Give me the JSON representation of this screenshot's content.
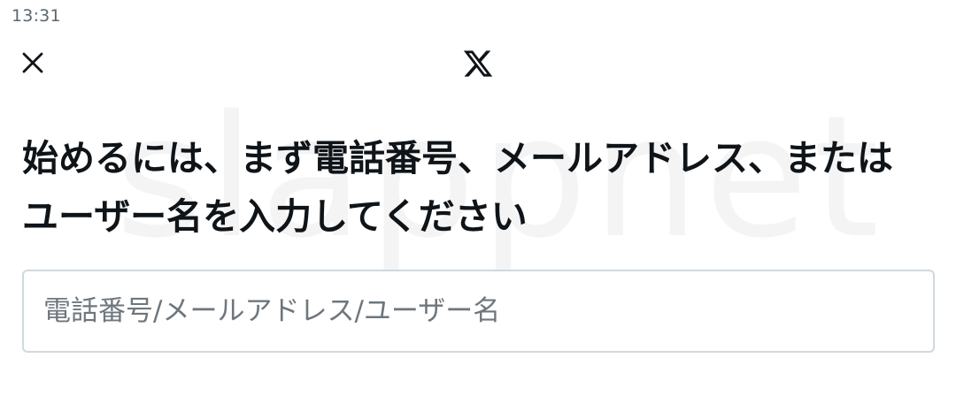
{
  "status_bar": {
    "time": "13:31"
  },
  "header": {
    "close_icon": "close-icon",
    "logo_icon": "x-logo-icon"
  },
  "watermark": {
    "text": "slappnet"
  },
  "main": {
    "heading": "始めるには、まず電話番号、メールアドレス、またはユーザー名を入力してください",
    "identifier_input": {
      "placeholder": "電話番号/メールアドレス/ユーザー名",
      "value": ""
    }
  }
}
